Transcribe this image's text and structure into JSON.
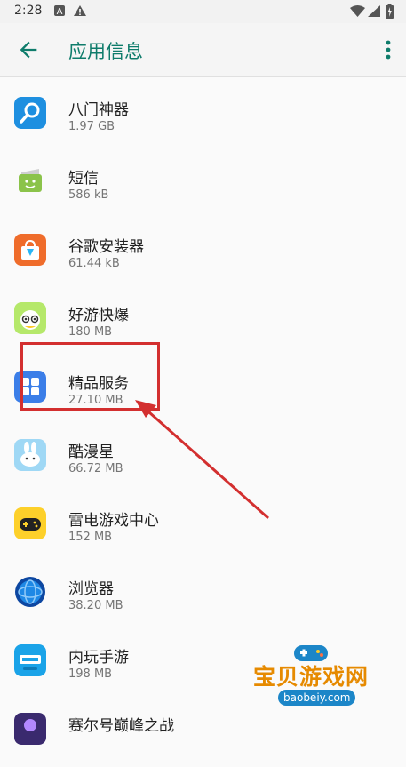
{
  "status_bar": {
    "time": "2:28",
    "icons": [
      "a-notification-icon",
      "warning-icon",
      "wifi-icon",
      "signal-icon",
      "battery-icon"
    ]
  },
  "app_bar": {
    "title": "应用信息",
    "back_icon": "arrow-left-icon",
    "menu_icon": "more-vert-icon",
    "accent": "#0e7c6b"
  },
  "apps": [
    {
      "name": "八门神器",
      "size": "1.97 GB",
      "icon": "key-search-icon"
    },
    {
      "name": "短信",
      "size": "586 kB",
      "icon": "sms-icon"
    },
    {
      "name": "谷歌安装器",
      "size": "61.44 kB",
      "icon": "google-installer-icon"
    },
    {
      "name": "好游快爆",
      "size": "180 MB",
      "icon": "haoyou-kuaibao-icon"
    },
    {
      "name": "精品服务",
      "size": "27.10 MB",
      "icon": "grid-apps-icon"
    },
    {
      "name": "酷漫星",
      "size": "66.72 MB",
      "icon": "bunny-icon"
    },
    {
      "name": "雷电游戏中心",
      "size": "152 MB",
      "icon": "gamepad-icon"
    },
    {
      "name": "浏览器",
      "size": "38.20 MB",
      "icon": "globe-icon"
    },
    {
      "name": "内玩手游",
      "size": "198 MB",
      "icon": "neiwan-icon"
    },
    {
      "name": "赛尔号巅峰之战",
      "size": "",
      "icon": "game-icon"
    }
  ],
  "annotation": {
    "highlight_color": "#d32f2f"
  },
  "watermark": {
    "title": "宝贝游戏网",
    "url": "baobeiy.com"
  }
}
